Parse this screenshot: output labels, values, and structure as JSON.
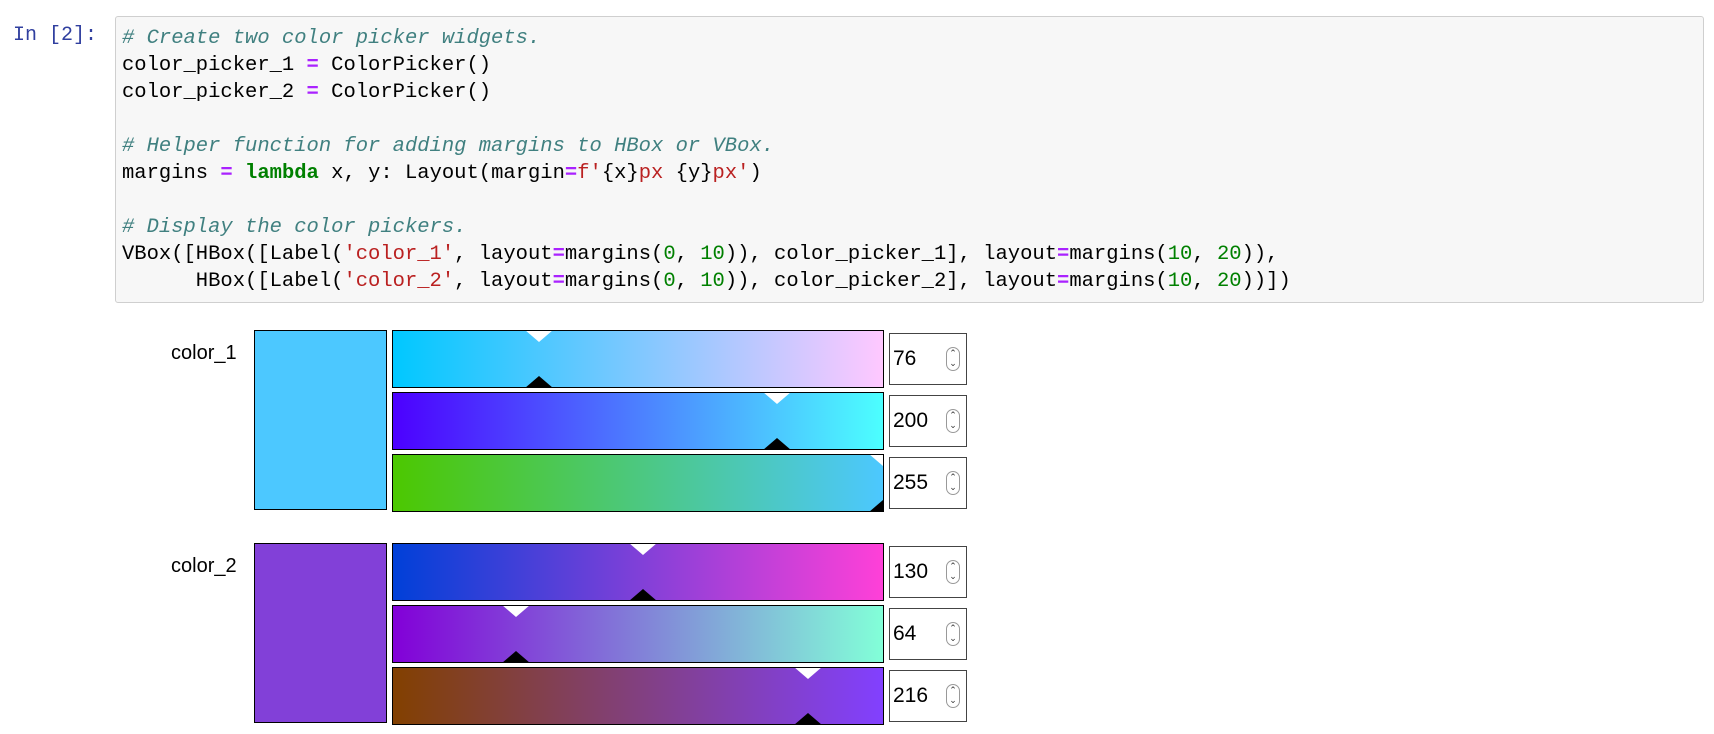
{
  "cell": {
    "prompt": "In [2]:",
    "code": {
      "line1_comment": "# Create two color picker widgets.",
      "line2_a": "color_picker_1 ",
      "line2_op": "=",
      "line2_b": " ColorPicker()",
      "line3_a": "color_picker_2 ",
      "line3_op": "=",
      "line3_b": " ColorPicker()",
      "line5_comment": "# Helper function for adding margins to HBox or VBox.",
      "line6_a": "margins ",
      "line6_op": "=",
      "line6_sp": " ",
      "line6_kw": "lambda",
      "line6_b": " x, y: Layout(margin",
      "line6_op2": "=",
      "line6_str1": "f'",
      "line6_c": "{x}",
      "line6_str2": "px ",
      "line6_d": "{y}",
      "line6_str3": "px'",
      "line6_e": ")",
      "line8_comment": "# Display the color pickers.",
      "line9_a": "VBox([HBox([Label(",
      "line9_str": "'color_1'",
      "line9_b": ", layout",
      "line9_op": "=",
      "line9_c": "margins(",
      "line9_n1": "0",
      "line9_d": ", ",
      "line9_n2": "10",
      "line9_e": ")), color_picker_1], layout",
      "line9_op2": "=",
      "line9_f": "margins(",
      "line9_n3": "10",
      "line9_g": ", ",
      "line9_n4": "20",
      "line9_h": ")),",
      "line10_a": "      HBox([Label(",
      "line10_str": "'color_2'",
      "line10_b": ", layout",
      "line10_op": "=",
      "line10_c": "margins(",
      "line10_n1": "0",
      "line10_d": ", ",
      "line10_n2": "10",
      "line10_e": ")), color_picker_2], layout",
      "line10_op2": "=",
      "line10_f": "margins(",
      "line10_n3": "10",
      "line10_g": ", ",
      "line10_n4": "20",
      "line10_h": "))])"
    }
  },
  "pickers": [
    {
      "label": "color_1",
      "swatch_color": "#4cc8ff",
      "channels": [
        {
          "value": "76",
          "level": 76,
          "gradient_from": "#00c8ff",
          "gradient_to": "#ffc8ff"
        },
        {
          "value": "200",
          "level": 200,
          "gradient_from": "#4c00ff",
          "gradient_to": "#4cffff"
        },
        {
          "value": "255",
          "level": 255,
          "gradient_from": "#4cc800",
          "gradient_to": "#4cc8ff"
        }
      ]
    },
    {
      "label": "color_2",
      "swatch_color": "#8240d8",
      "channels": [
        {
          "value": "130",
          "level": 130,
          "gradient_from": "#0040d8",
          "gradient_to": "#ff40d8"
        },
        {
          "value": "64",
          "level": 64,
          "gradient_from": "#8200d8",
          "gradient_to": "#82ffd8"
        },
        {
          "value": "216",
          "level": 216,
          "gradient_from": "#824000",
          "gradient_to": "#8240ff"
        }
      ]
    }
  ],
  "icons": {
    "spinner": "up-down-spinner-icon"
  }
}
